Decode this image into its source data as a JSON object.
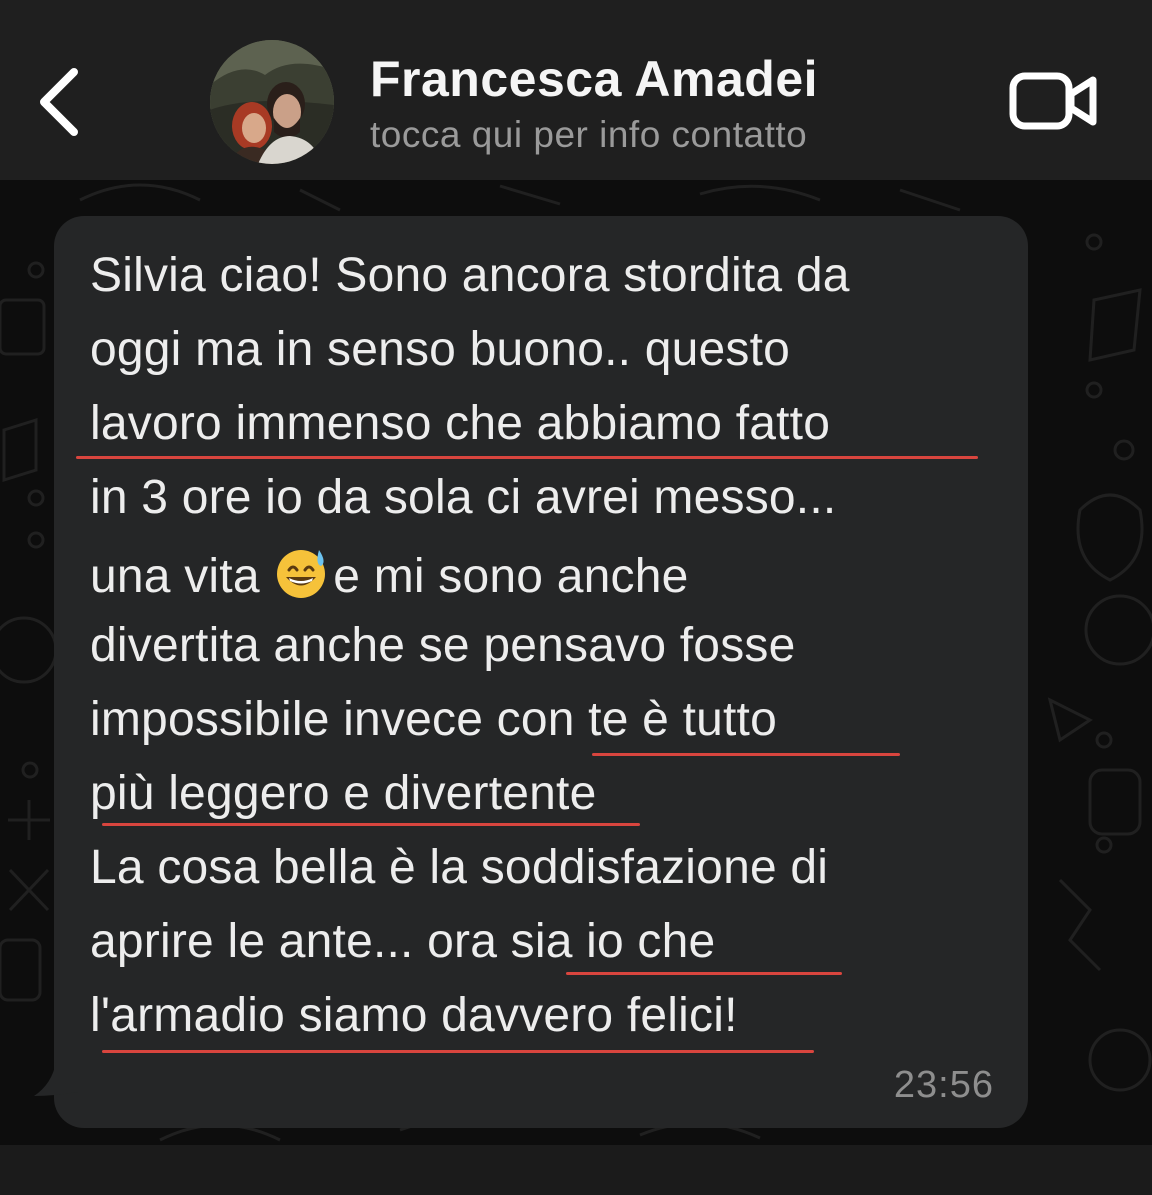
{
  "header": {
    "back_icon": "chevron-left-icon",
    "name": "Francesca Amadei",
    "subtitle": "tocca qui per info contatto",
    "video_icon": "video-camera-icon"
  },
  "message": {
    "lines": [
      "Silvia ciao! Sono ancora stordita da",
      "oggi ma in senso buono.. questo",
      "lavoro immenso che abbiamo fatto",
      "in 3 ore io da sola ci avrei messo...",
      "una vita",
      "e mi sono anche",
      "divertita anche se pensavo fosse",
      "impossibile invece con te è tutto",
      "più leggero e divertente",
      "La cosa bella è la soddisfazione di",
      "aprire le ante... ora sia io che",
      "l'armadio siamo davvero felici!"
    ],
    "emoji": "grinning-face-with-sweat-emoji",
    "time": "23:56"
  },
  "colors": {
    "header_bg": "#1f1f1f",
    "bubble_bg": "#252627",
    "text": "#ededed",
    "underline": "#d9453e"
  }
}
